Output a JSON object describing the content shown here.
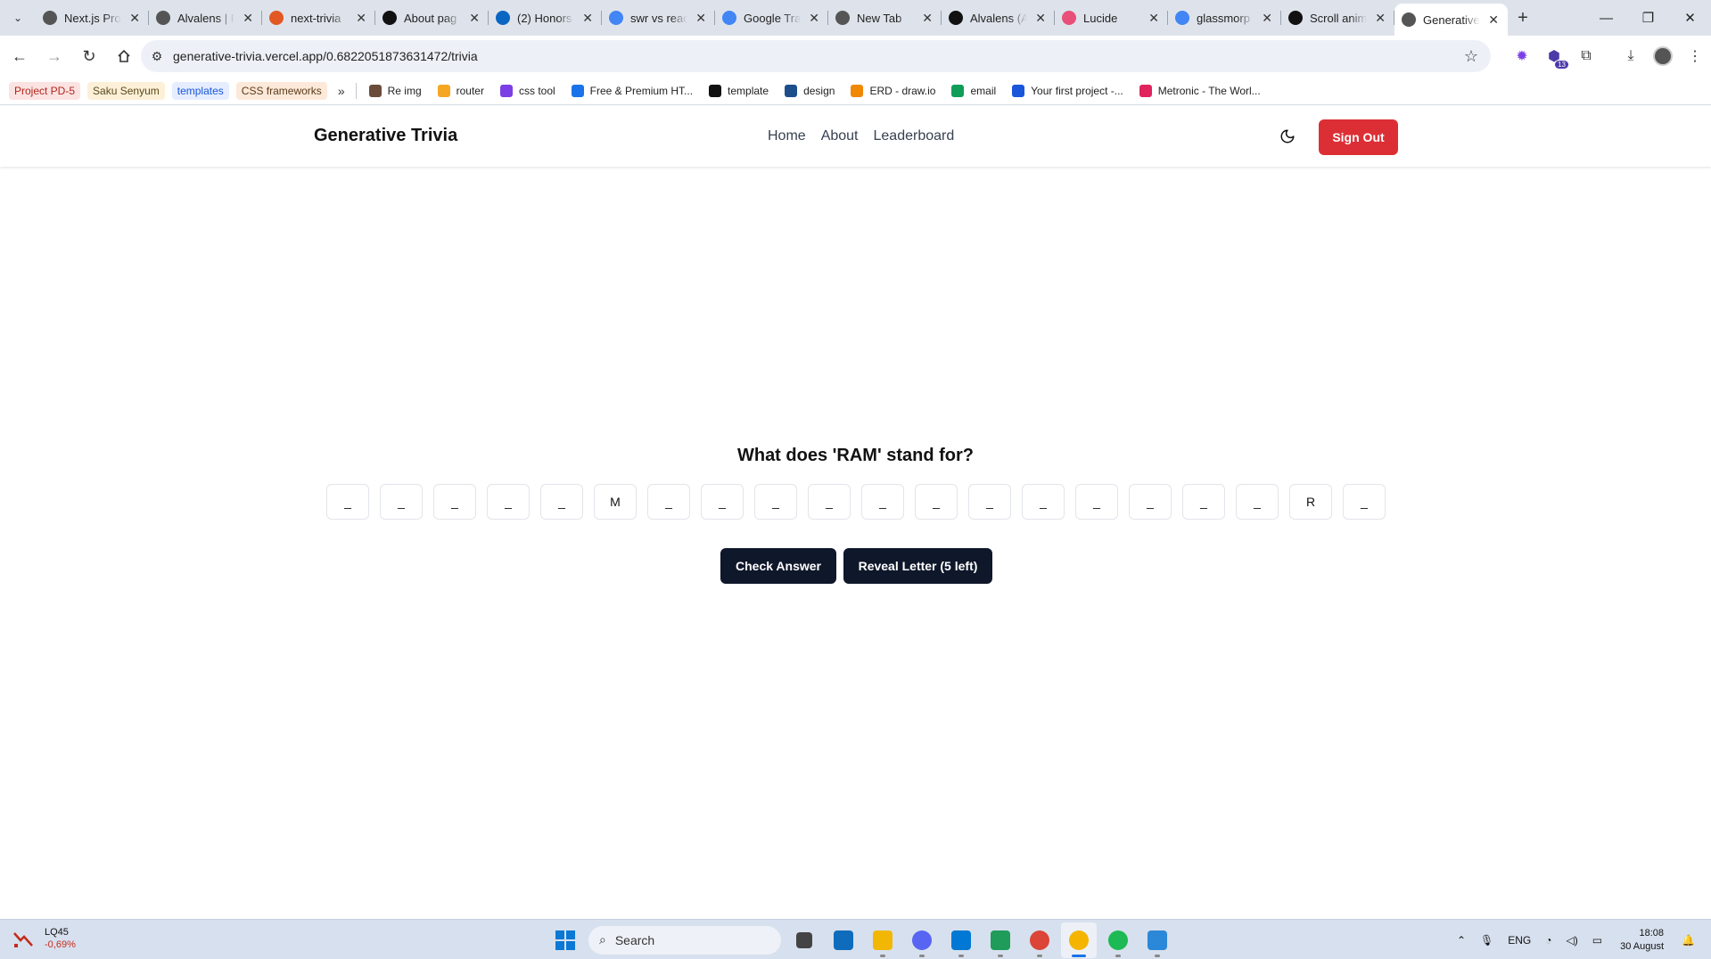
{
  "browser": {
    "tabs": [
      {
        "title": "Next.js Pro",
        "fav_color": "#555"
      },
      {
        "title": "Alvalens | F",
        "fav_color": "#555"
      },
      {
        "title": "next-trivia",
        "fav_color": "#e25822"
      },
      {
        "title": "About pag",
        "fav_color": "#111"
      },
      {
        "title": "(2) Honors",
        "fav_color": "#0a66c2"
      },
      {
        "title": "swr vs reac",
        "fav_color": "#4285f4"
      },
      {
        "title": "Google Tra",
        "fav_color": "#4285f4"
      },
      {
        "title": "New Tab",
        "fav_color": "#555"
      },
      {
        "title": "Alvalens (A",
        "fav_color": "#111"
      },
      {
        "title": "Lucide",
        "fav_color": "#e8507a"
      },
      {
        "title": "glassmorp",
        "fav_color": "#4285f4"
      },
      {
        "title": "Scroll anim",
        "fav_color": "#111"
      },
      {
        "title": "Generative",
        "fav_color": "#555",
        "active": true
      }
    ],
    "url": "generative-trivia.vercel.app/0.6822051873631472/trivia",
    "extension_badge": "13",
    "bookmark_chips": [
      {
        "label": "Project PD-5",
        "style": "red"
      },
      {
        "label": "Saku Senyum",
        "style": "yellow"
      },
      {
        "label": "templates",
        "style": "blue"
      },
      {
        "label": "CSS frameworks",
        "style": "orange"
      }
    ],
    "bookmarks": [
      {
        "label": "Re img",
        "color": "#6b4c3b"
      },
      {
        "label": "router",
        "color": "#f5a623"
      },
      {
        "label": "css tool",
        "color": "#7b3fe4"
      },
      {
        "label": "Free & Premium HT...",
        "color": "#1a73e8"
      },
      {
        "label": "template",
        "color": "#111"
      },
      {
        "label": "design",
        "color": "#1c4e8c"
      },
      {
        "label": "ERD - draw.io",
        "color": "#f08705"
      },
      {
        "label": "email",
        "color": "#0f9d58"
      },
      {
        "label": "Your first project -...",
        "color": "#1a56db"
      },
      {
        "label": "Metronic - The Worl...",
        "color": "#e0245e"
      }
    ]
  },
  "site": {
    "brand": "Generative Trivia",
    "nav": [
      "Home",
      "About",
      "Leaderboard"
    ],
    "sign_out": "Sign Out"
  },
  "trivia": {
    "question": "What does 'RAM' stand for?",
    "letters": [
      "_",
      "_",
      "_",
      "_",
      "_",
      "M",
      "_",
      "_",
      "_",
      "_",
      "_",
      "_",
      "_",
      "_",
      "_",
      "_",
      "_",
      "_",
      "R",
      "_"
    ],
    "check_label": "Check Answer",
    "reveal_label": "Reveal Letter (5 left)"
  },
  "taskbar": {
    "stock_name": "LQ45",
    "stock_change": "-0,69%",
    "search_placeholder": "Search",
    "apps": [
      {
        "name": "file-explorer",
        "color": "#f2b705"
      },
      {
        "name": "discord",
        "color": "#5865f2"
      },
      {
        "name": "vscode",
        "color": "#0078d4"
      },
      {
        "name": "vscode-insiders",
        "color": "#1f9c5a"
      },
      {
        "name": "chrome",
        "color": "#db4437"
      },
      {
        "name": "chrome-profile",
        "color": "#f4b400",
        "active": true
      },
      {
        "name": "spotify",
        "color": "#1db954"
      },
      {
        "name": "notepad",
        "color": "#2b88d8"
      }
    ],
    "lang": "ENG",
    "time": "18:08",
    "date": "30 August"
  }
}
